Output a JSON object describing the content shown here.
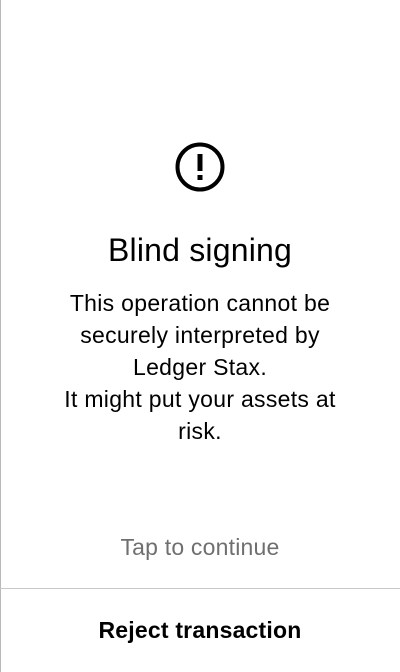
{
  "screen": {
    "icon": "warning-circle-icon",
    "title": "Blind signing",
    "description_lines": [
      "This operation cannot be",
      "securely interpreted by",
      "Ledger Stax.",
      "It might put your assets at",
      "risk."
    ],
    "tap_hint": "Tap to continue"
  },
  "footer": {
    "reject_label": "Reject transaction"
  }
}
